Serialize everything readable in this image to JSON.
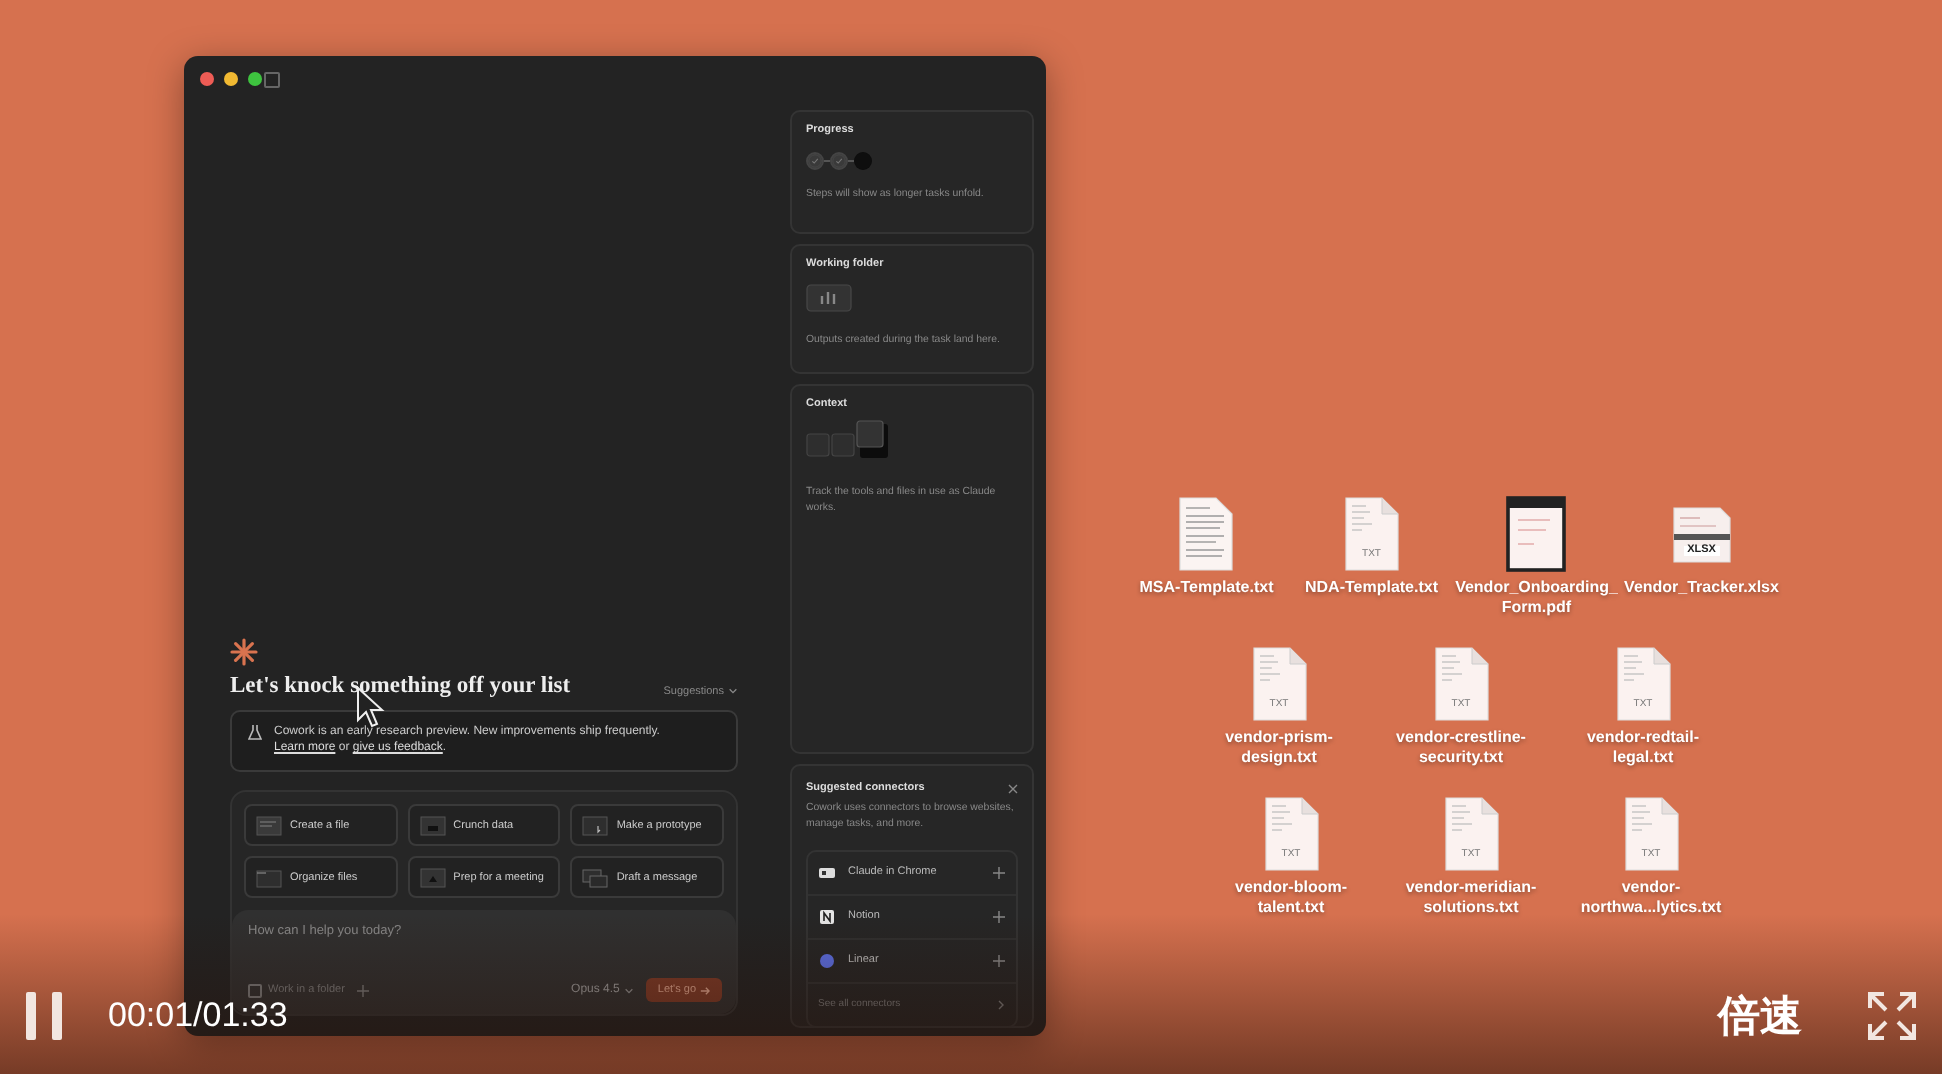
{
  "app_window": {
    "main": {
      "heading": "Let's knock something off your list",
      "suggestions_label": "Suggestions",
      "notice": [
        {
          "kind": "text",
          "text": "Cowork is an early research preview. New improvements ship frequently. "
        },
        {
          "kind": "link",
          "text": "Learn more"
        },
        {
          "kind": "text",
          "text": " or "
        },
        {
          "kind": "link",
          "text": "give us feedback"
        },
        {
          "kind": "text",
          "text": "."
        }
      ],
      "tasks": [
        {
          "label": "Create a file",
          "kind": "file"
        },
        {
          "label": "Crunch data",
          "kind": "data"
        },
        {
          "label": "Make a prototype",
          "kind": "prototype"
        },
        {
          "label": "Organize files",
          "kind": "folder"
        },
        {
          "label": "Prep for a meeting",
          "kind": "meeting"
        },
        {
          "label": "Draft a message",
          "kind": "message"
        }
      ],
      "composer": {
        "placeholder": "How can I help you today?",
        "folder_label": "Work in a folder",
        "folder_checked": false,
        "model": "Opus 4.5",
        "submit": "Let's go"
      }
    },
    "panel": {
      "progress": {
        "title": "Progress",
        "steps": [
          {
            "done": true
          },
          {
            "done": true
          },
          {
            "done": false
          }
        ],
        "hint": "Steps will show as longer tasks unfold."
      },
      "working_folder": {
        "title": "Working folder",
        "hint": "Outputs created during the task land here."
      },
      "context": {
        "title": "Context",
        "hint": "Track the tools and files in use as Claude works."
      },
      "connectors": {
        "title": "Suggested connectors",
        "description": "Cowork uses connectors to browse websites, manage tasks, and more.",
        "items": [
          {
            "name": "Claude in Chrome",
            "kind": "chrome"
          },
          {
            "name": "Notion",
            "kind": "notion"
          },
          {
            "name": "Linear",
            "kind": "linear"
          }
        ],
        "see_all": "See all connectors"
      }
    }
  },
  "desktop_rows": [
    [
      {
        "name": "MSA-Template.txt",
        "kind": "text-preview"
      },
      {
        "name": "NDA-Template.txt",
        "kind": "txt",
        "badge": "TXT"
      },
      {
        "name": "Vendor_Onboarding_Form.pdf",
        "kind": "pdf"
      },
      {
        "name": "Vendor_Tracker.xlsx",
        "kind": "spreadsheet",
        "badge": "XLSX"
      }
    ],
    [
      {
        "name": "vendor-prism-design.txt",
        "kind": "txt",
        "badge": "TXT"
      },
      {
        "name": "vendor-crestline-security.txt",
        "kind": "txt",
        "badge": "TXT"
      },
      {
        "name": "vendor-redtail-legal.txt",
        "kind": "txt",
        "badge": "TXT"
      }
    ],
    [
      {
        "name": "vendor-bloom-talent.txt",
        "kind": "txt",
        "badge": "TXT"
      },
      {
        "name": "vendor-meridian-solutions.txt",
        "kind": "txt",
        "badge": "TXT"
      },
      {
        "name": "vendor-northwa...lytics.txt",
        "kind": "txt",
        "badge": "TXT"
      }
    ]
  ],
  "video_player": {
    "playing": true,
    "time": "00:01/01:33",
    "speed": "倍速"
  }
}
